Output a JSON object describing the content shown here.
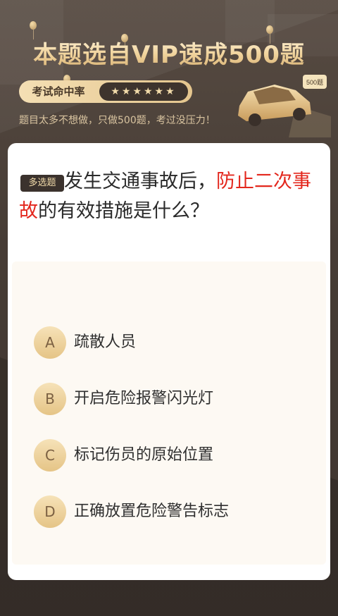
{
  "banner": {
    "title": "本题选自VIP速成500题",
    "rate_label": "考试命中率",
    "rate_stars": "★★★★★★",
    "tagline": "题目太多不想做，只做500题，考过没压力！",
    "car_sign": "500题"
  },
  "question": {
    "type_badge": "多选题",
    "text_before": "发生交通事故后，",
    "text_highlight": "防止二次事故",
    "text_after": "的有效措施是什么？",
    "highlight_color": "#e3271d"
  },
  "options": [
    {
      "key": "A",
      "text": "疏散人员"
    },
    {
      "key": "B",
      "text": "开启危险报警闪光灯"
    },
    {
      "key": "C",
      "text": "标记伤员的原始位置"
    },
    {
      "key": "D",
      "text": "正确放置危险警告标志"
    }
  ],
  "colors": {
    "background": "#4a4039",
    "gold": "#e5c486",
    "badge_bg": "#3b322d"
  }
}
